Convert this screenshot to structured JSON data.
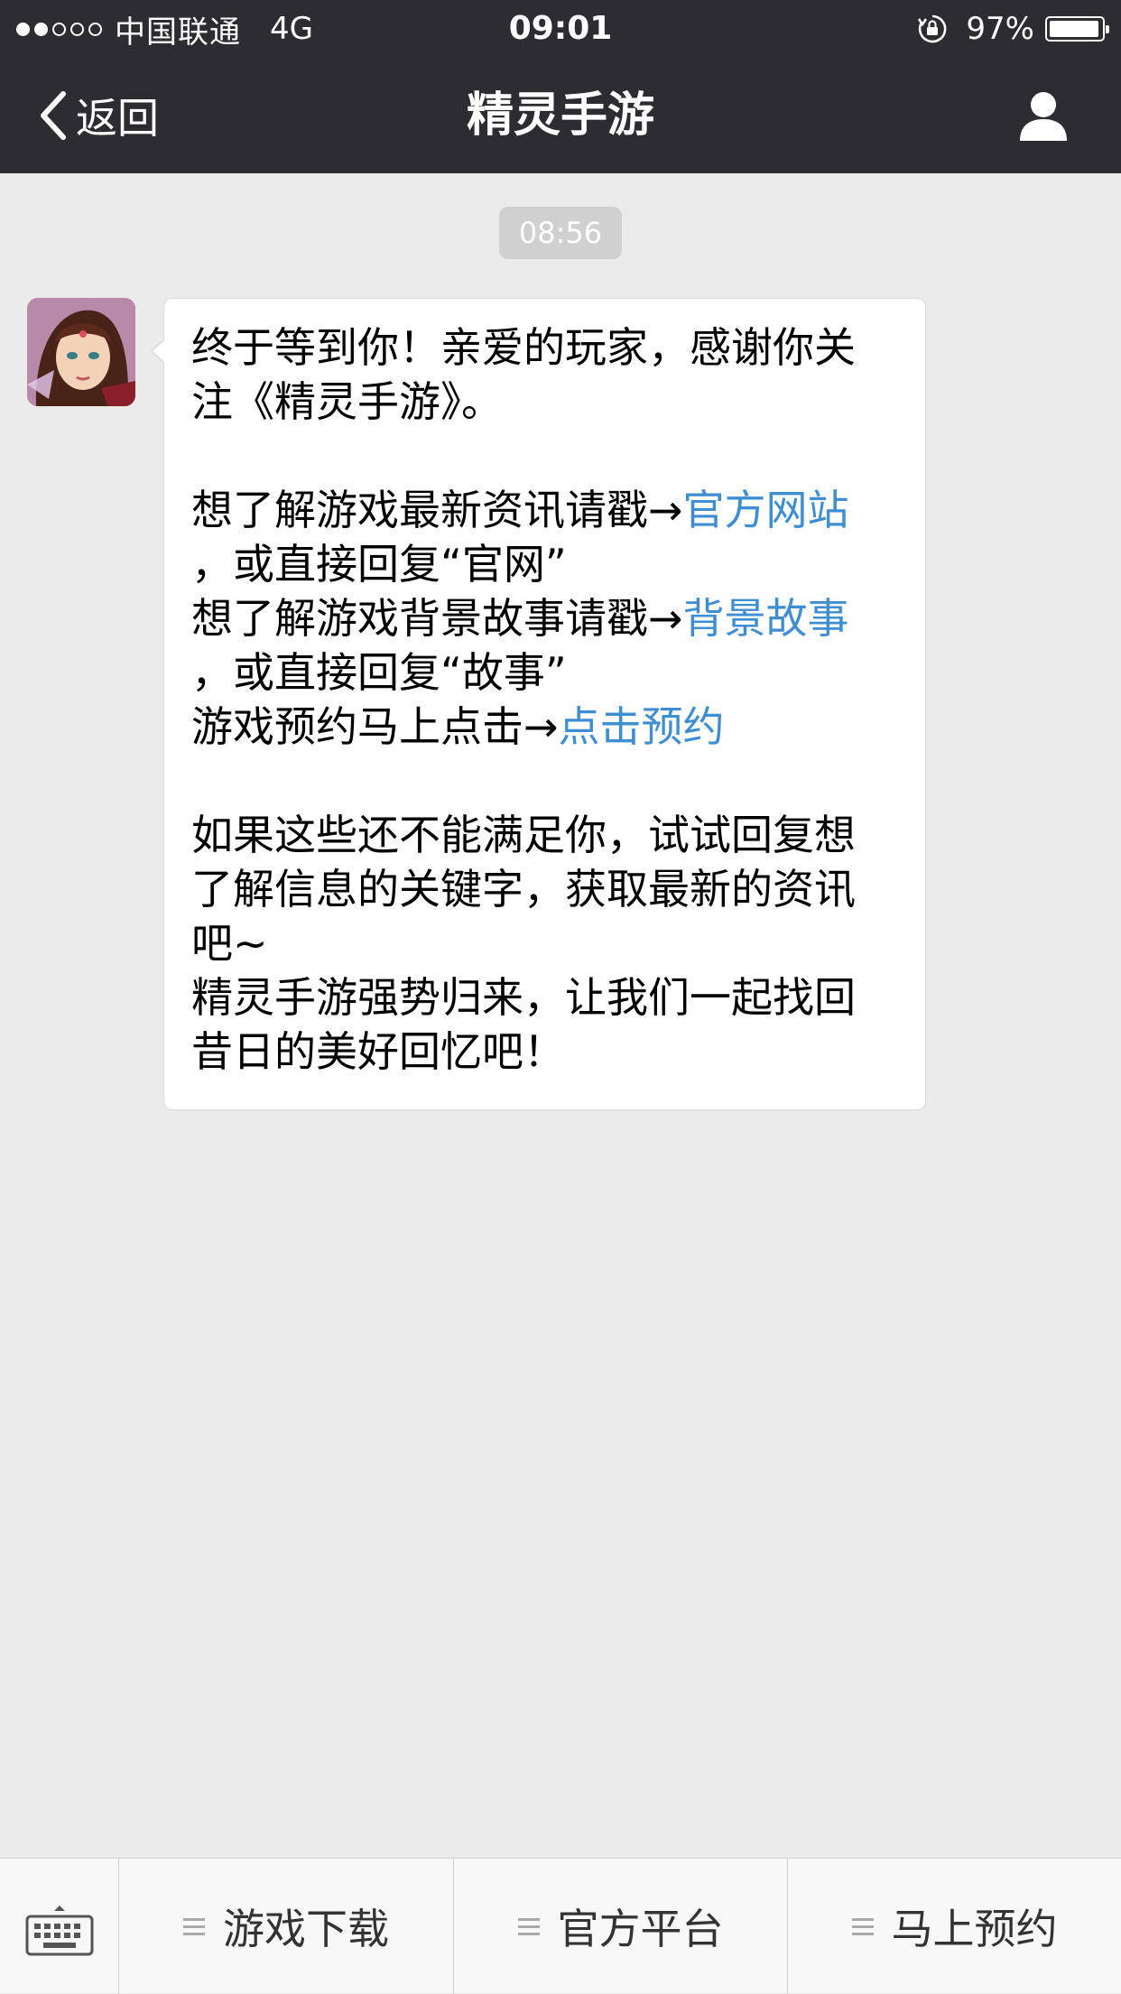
{
  "status_bar": {
    "signal_filled": 2,
    "signal_total": 5,
    "carrier": "中国联通",
    "network": "4G",
    "time": "09:01",
    "battery_text": "97%",
    "battery_level": 0.97
  },
  "nav": {
    "back_label": "返回",
    "title": "精灵手游",
    "profile_icon": "person-icon"
  },
  "chat": {
    "timestamp": "08:56",
    "message": {
      "lines": [
        {
          "text": "终于等到你！亲爱的玩家，感谢你关"
        },
        {
          "text": "注《精灵手游》。"
        },
        {
          "prefix": "想了解游戏最新资讯请戳→",
          "link": "官方网站"
        },
        {
          "text": "，或直接回复“官网”"
        },
        {
          "prefix": "想了解游戏背景故事请戳→",
          "link": "背景故事"
        },
        {
          "text": "，或直接回复“故事”"
        },
        {
          "prefix": "游戏预约马上点击→",
          "link": "点击预约"
        },
        {
          "text": "如果这些还不能满足你，试试回复想"
        },
        {
          "text": "了解信息的关键字，获取最新的资讯"
        },
        {
          "text": "吧~"
        },
        {
          "text": "精灵手游强势归来，让我们一起找回"
        },
        {
          "text": "昔日的美好回忆吧！"
        }
      ]
    }
  },
  "bottom_menu": {
    "keyboard_icon": "keyboard-icon",
    "items": [
      {
        "label": "游戏下载"
      },
      {
        "label": "官方平台"
      },
      {
        "label": "马上预约"
      }
    ]
  },
  "colors": {
    "bar_bg": "#2d2c31",
    "chat_bg": "#ebebeb",
    "link": "#3f8ed1"
  }
}
